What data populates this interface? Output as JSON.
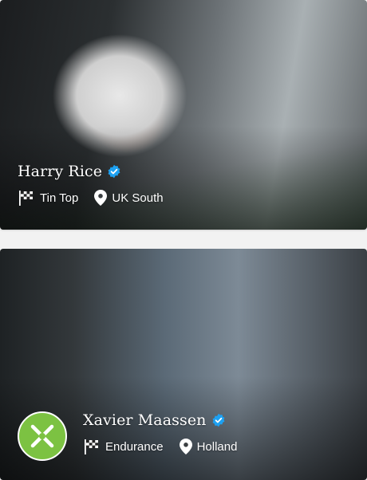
{
  "cards": [
    {
      "name": "Harry Rice",
      "verified": true,
      "category": "Tin Top",
      "location": "UK South"
    },
    {
      "name": "Xavier Maassen",
      "verified": true,
      "category": "Endurance",
      "location": "Holland"
    }
  ],
  "colors": {
    "verified_badge": "#1da1f2",
    "avatar_green": "#7cc242",
    "text": "#ffffff",
    "page_background": "#f2f2f2"
  },
  "icons": {
    "category": "checkered-flag-icon",
    "location": "map-pin-icon",
    "verified": "verified-check-icon",
    "avatar": "crossed-logo-icon"
  }
}
